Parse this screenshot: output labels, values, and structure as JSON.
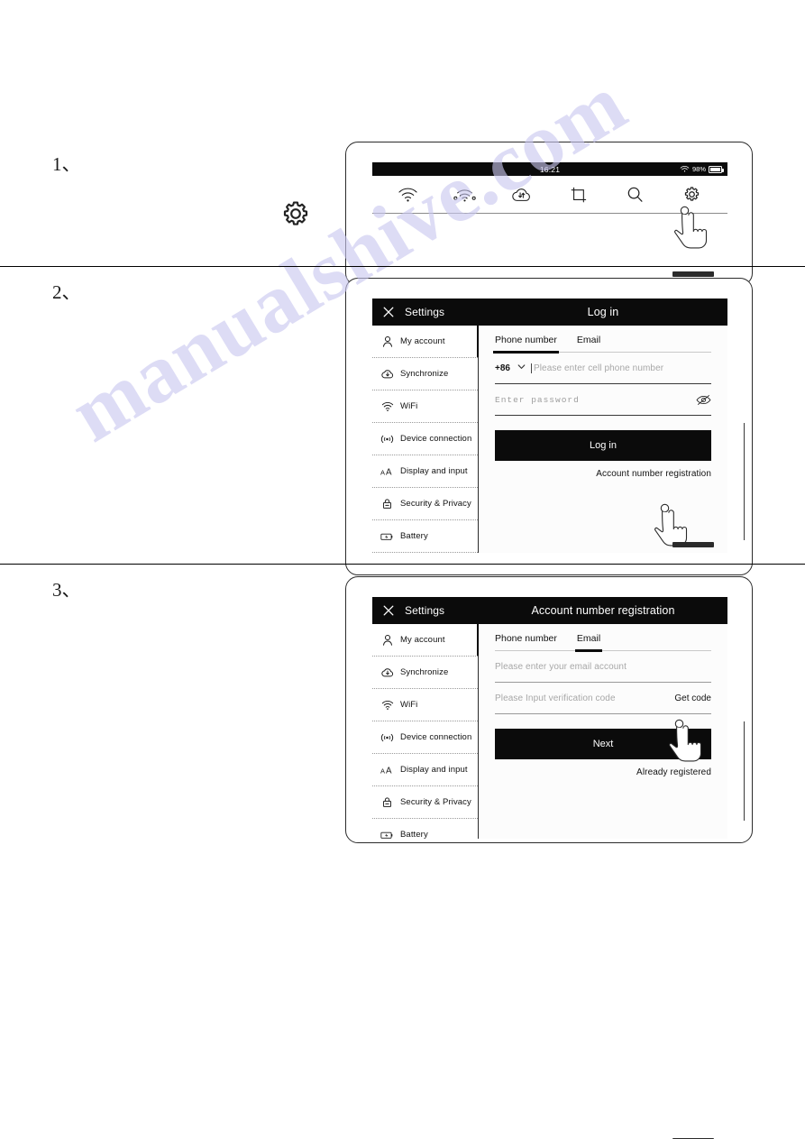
{
  "document": {
    "watermark": "manualshive.com"
  },
  "steps": [
    {
      "number": "1、"
    },
    {
      "number": "2、"
    },
    {
      "number": "3、"
    }
  ],
  "step1": {
    "callout_icon": "gear-icon",
    "statusbar": {
      "time": "16:21",
      "wifi_icon": "wifi-icon",
      "battery_percent": "98%",
      "battery_icon": "battery-icon"
    },
    "toolbar": {
      "items": [
        {
          "icon": "wifi-icon",
          "name": "wifi"
        },
        {
          "icon": "wireless-share-icon",
          "name": "wireless-share"
        },
        {
          "icon": "cloud-sync-icon",
          "name": "cloud-sync"
        },
        {
          "icon": "crop-icon",
          "name": "crop"
        },
        {
          "icon": "search-icon",
          "name": "search"
        },
        {
          "icon": "gear-icon",
          "name": "settings"
        }
      ]
    }
  },
  "settings_window": {
    "close_icon": "close-icon",
    "app_label": "Settings",
    "sidebar": [
      {
        "label": "My account",
        "icon": "person-icon",
        "active": true
      },
      {
        "label": "Synchronize",
        "icon": "cloud-download-icon",
        "active": false
      },
      {
        "label": "WiFi",
        "icon": "wifi-icon",
        "active": false
      },
      {
        "label": "Device connection",
        "icon": "device-connection-icon",
        "active": false
      },
      {
        "label": "Display and input",
        "icon": "font-size-icon",
        "active": false
      },
      {
        "label": "Security & Privacy",
        "icon": "lock-icon",
        "active": false
      },
      {
        "label": "Battery",
        "icon": "battery-icon",
        "active": false
      }
    ]
  },
  "step2": {
    "title": "Log in",
    "tabs": [
      {
        "label": "Phone number",
        "selected": true
      },
      {
        "label": "Email",
        "selected": false
      }
    ],
    "country_code": "+86",
    "chevron_icon": "chevron-down-icon",
    "phone_placeholder": "Please enter cell phone number",
    "password_placeholder": "Enter password",
    "password_toggle_icon": "eye-off-icon",
    "submit_label": "Log in",
    "secondary_link": "Account number registration",
    "pointer_icon": "hand-pointer-icon"
  },
  "step3": {
    "title": "Account number registration",
    "tabs": [
      {
        "label": "Phone number",
        "selected": false
      },
      {
        "label": "Email",
        "selected": true
      }
    ],
    "email_placeholder": "Please enter your email account",
    "code_placeholder": "Please Input verification code",
    "get_code_label": "Get code",
    "submit_label": "Next",
    "secondary_link": "Already registered",
    "pointer_icon": "hand-pointer-icon"
  }
}
